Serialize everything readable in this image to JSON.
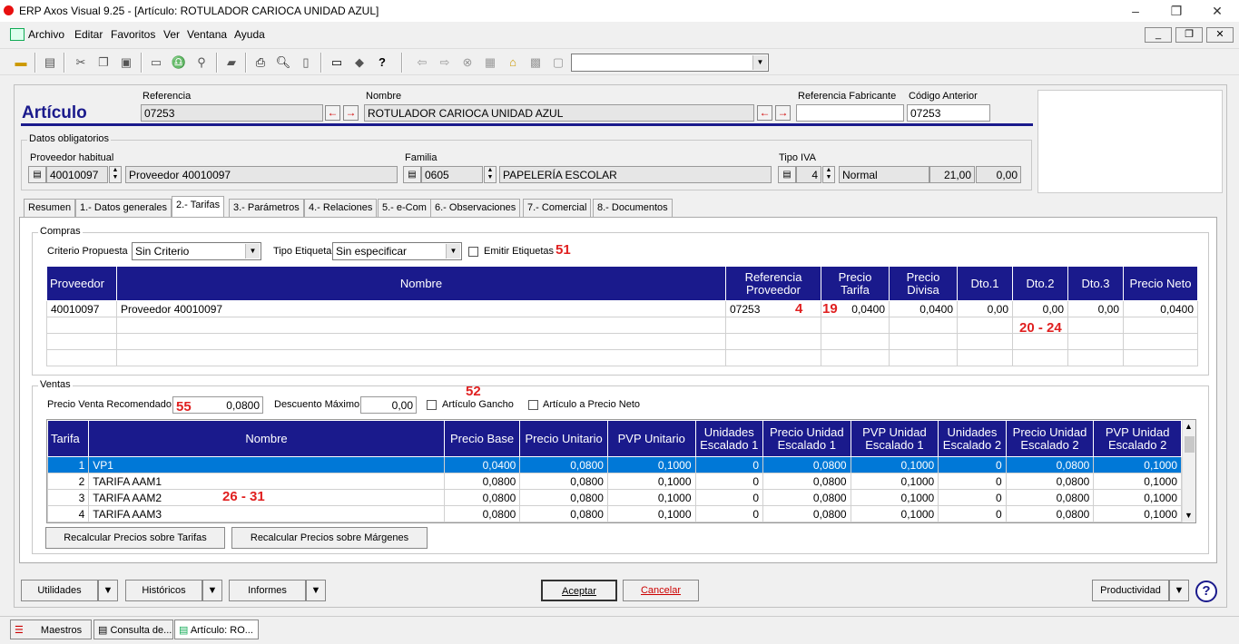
{
  "window": {
    "title": "ERP Axos Visual 9.25 - [Artículo: ROTULADOR CARIOCA UNIDAD AZUL]",
    "min": "–",
    "max": "❐",
    "close": "✕"
  },
  "menu": [
    "Archivo",
    "Editar",
    "Favoritos",
    "Ver",
    "Ventana",
    "Ayuda"
  ],
  "mdi": {
    "min": "_",
    "restore": "❐",
    "close": "✕"
  },
  "header": {
    "title": "Artículo",
    "ref_label": "Referencia",
    "ref_value": "07253",
    "name_label": "Nombre",
    "name_value": "ROTULADOR CARIOCA UNIDAD AZUL",
    "ref_fab_label": "Referencia Fabricante",
    "ref_fab_value": "",
    "cod_ant_label": "Código Anterior",
    "cod_ant_value": "07253"
  },
  "datos": {
    "title": "Datos obligatorios",
    "prov_label": "Proveedor habitual",
    "prov_code": "40010097",
    "prov_name": "Proveedor 40010097",
    "fam_label": "Familia",
    "fam_code": "0605",
    "fam_name": "PAPELERÍA ESCOLAR",
    "iva_label": "Tipo IVA",
    "iva_code": "4",
    "iva_name": "Normal",
    "iva_pct": "21,00",
    "iva_re": "0,00"
  },
  "tabs": [
    "Resumen",
    "1.- Datos generales",
    "2.- Tarifas",
    "3.- Parámetros",
    "4.- Relaciones",
    "5.- e-Com",
    "6.- Observaciones",
    "7.- Comercial",
    "8.- Documentos"
  ],
  "compras": {
    "title": "Compras",
    "criterio_label": "Criterio Propuesta",
    "criterio_value": "Sin Criterio",
    "etiqueta_label": "Tipo Etiqueta",
    "etiqueta_value": "Sin especificar",
    "emitir_label": "Emitir Etiquetas",
    "columns": [
      "Proveedor",
      "Nombre",
      "Referencia Proveedor",
      "Precio Tarifa",
      "Precio Divisa",
      "Dto.1",
      "Dto.2",
      "Dto.3",
      "Precio Neto"
    ],
    "rows": [
      [
        "40010097",
        "Proveedor 40010097",
        "07253",
        "0,0400",
        "0,0400",
        "0,00",
        "0,00",
        "0,00",
        "0,0400"
      ]
    ]
  },
  "ventas": {
    "title": "Ventas",
    "pvr_label": "Precio Venta Recomendado",
    "pvr_value": "0,0800",
    "dto_label": "Descuento Máximo",
    "dto_value": "0,00",
    "gancho_label": "Artículo Gancho",
    "neto_label": "Artículo a Precio Neto",
    "columns": [
      "Tarifa",
      "Nombre",
      "Precio Base",
      "Precio Unitario",
      "PVP Unitario",
      "Unidades Escalado 1",
      "Precio Unidad Escalado 1",
      "PVP Unidad Escalado 1",
      "Unidades Escalado 2",
      "Precio Unidad Escalado 2",
      "PVP Unidad Escalado 2"
    ],
    "rows": [
      [
        "1",
        "VP1",
        "0,0400",
        "0,0800",
        "0,1000",
        "0",
        "0,0800",
        "0,1000",
        "0",
        "0,0800",
        "0,1000"
      ],
      [
        "2",
        "TARIFA AAM1",
        "0,0800",
        "0,0800",
        "0,1000",
        "0",
        "0,0800",
        "0,1000",
        "0",
        "0,0800",
        "0,1000"
      ],
      [
        "3",
        "TARIFA AAM2",
        "0,0800",
        "0,0800",
        "0,1000",
        "0",
        "0,0800",
        "0,1000",
        "0",
        "0,0800",
        "0,1000"
      ],
      [
        "4",
        "TARIFA AAM3",
        "0,0800",
        "0,0800",
        "0,1000",
        "0",
        "0,0800",
        "0,1000",
        "0",
        "0,0800",
        "0,1000"
      ]
    ],
    "recalc_tarifas": "Recalcular Precios sobre Tarifas",
    "recalc_margenes": "Recalcular Precios sobre Márgenes"
  },
  "annotations": {
    "a51": "51",
    "a4": "4",
    "a19": "19",
    "a20": "20 - 24",
    "a52": "52",
    "a55": "55",
    "a26": "26 - 31"
  },
  "bottom": {
    "utilidades": "Utilidades",
    "historicos": "Históricos",
    "informes": "Informes",
    "aceptar": "Aceptar",
    "cancelar": "Cancelar",
    "productividad": "Productividad",
    "help": "?"
  },
  "taskbar": [
    "Maestros",
    "Consulta de...",
    "Artículo: RO..."
  ]
}
